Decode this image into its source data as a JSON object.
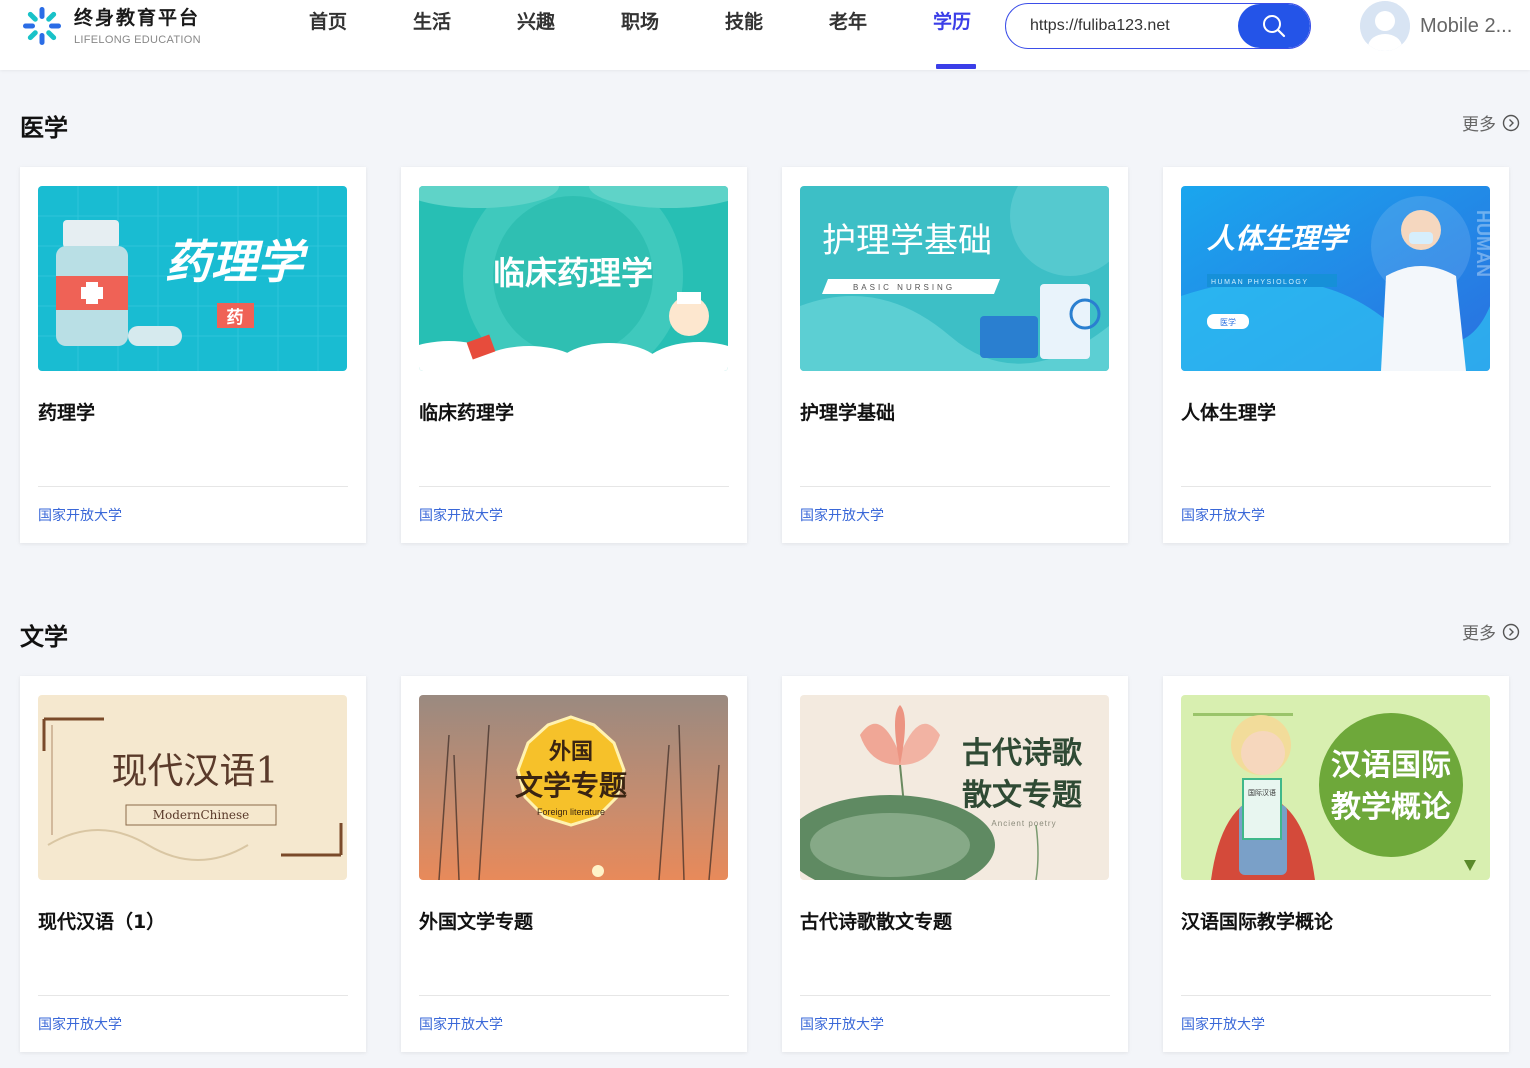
{
  "header": {
    "logo_title": "终身教育平台",
    "logo_subtitle": "LIFELONG EDUCATION",
    "nav": [
      "首页",
      "生活",
      "兴趣",
      "职场",
      "技能",
      "老年",
      "学历"
    ],
    "active_nav": "学历",
    "search_value": "https://fuliba123.net",
    "user_name": "Mobile 2..."
  },
  "colors": {
    "accent": "#3b3ee8",
    "search_button": "#2454e8",
    "source_link": "#3a68d8"
  },
  "sections": [
    {
      "title": "医学",
      "more": "更多",
      "cards": [
        {
          "title": "药理学",
          "source": "国家开放大学",
          "banner_text": "药理学",
          "banner_tag": "药"
        },
        {
          "title": "临床药理学",
          "source": "国家开放大学",
          "banner_text": "临床药理学"
        },
        {
          "title": "护理学基础",
          "source": "国家开放大学",
          "banner_text": "护理学基础",
          "banner_sub": "BASIC NURSING"
        },
        {
          "title": "人体生理学",
          "source": "国家开放大学",
          "banner_text": "人体生理学",
          "banner_sub": "HUMAN PHYSIOLOGY",
          "banner_tag": "医学",
          "banner_side": "HUMAN"
        }
      ]
    },
    {
      "title": "文学",
      "more": "更多",
      "cards": [
        {
          "title": "现代汉语（1）",
          "source": "国家开放大学",
          "banner_text": "现代汉语1",
          "banner_sub": "ModernChinese"
        },
        {
          "title": "外国文学专题",
          "source": "国家开放大学",
          "banner_line1": "外国",
          "banner_line2": "文学专题",
          "banner_sub": "Foreign literature"
        },
        {
          "title": "古代诗歌散文专题",
          "source": "国家开放大学",
          "banner_line1": "古代诗歌",
          "banner_line2": "散文专题",
          "banner_sub": "Ancient poetry"
        },
        {
          "title": "汉语国际教学概论",
          "source": "国家开放大学",
          "banner_line1": "汉语国际",
          "banner_line2": "教学概论",
          "banner_tag": "国际汉语"
        }
      ]
    }
  ]
}
